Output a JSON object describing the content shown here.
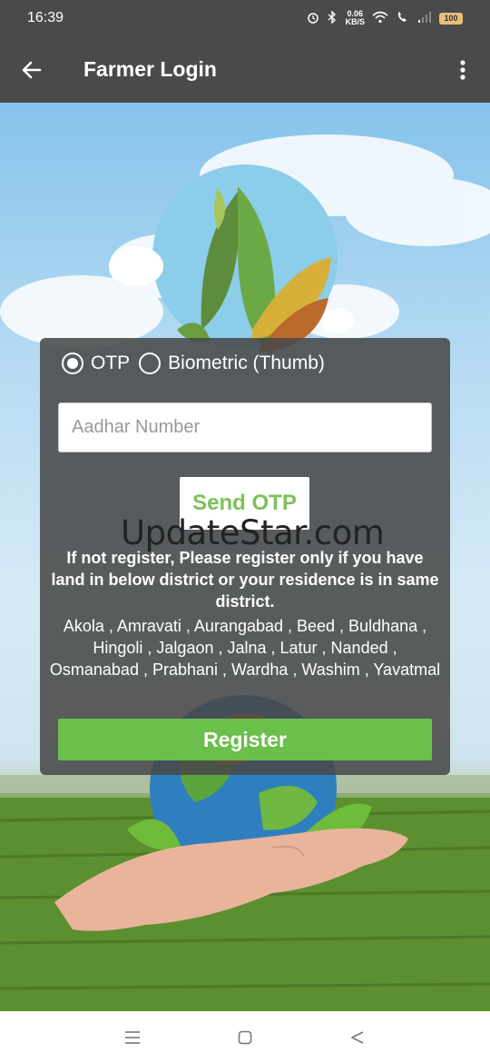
{
  "status_bar": {
    "time": "16:39",
    "speed_value": "0.06",
    "speed_unit": "KB/S",
    "battery": "100",
    "icons": [
      "alarm-icon",
      "bluetooth-icon",
      "wifi-icon",
      "volte-call-icon",
      "signal-icon",
      "battery-icon"
    ]
  },
  "app_bar": {
    "title": "Farmer Login",
    "back_icon": "arrow-left-icon",
    "menu_icon": "more-vert-icon"
  },
  "login_form": {
    "auth_options": [
      {
        "label": "OTP",
        "selected": true
      },
      {
        "label": "Biometric (Thumb)",
        "selected": false
      }
    ],
    "aadhar_placeholder": "Aadhar Number",
    "aadhar_value": "",
    "send_otp_label": "Send OTP",
    "notice": "If not register, Please register only if you have land in below district or your residence is in same district.",
    "districts": "Akola , Amravati , Aurangabad , Beed , Buldhana , Hingoli , Jalgaon , Jalna , Latur , Nanded , Osmanabad , Prabhani , Wardha , Washim , Yavatmal",
    "register_label": "Register"
  },
  "watermark": "UpdateStar.com",
  "colors": {
    "app_bar": "#4a4a4a",
    "accent_green": "#6bbf4b",
    "send_otp_text": "#7cc25a"
  },
  "nav_bar": {
    "icons": [
      "menu-lines-icon",
      "square-home-icon",
      "triangle-back-icon"
    ]
  }
}
